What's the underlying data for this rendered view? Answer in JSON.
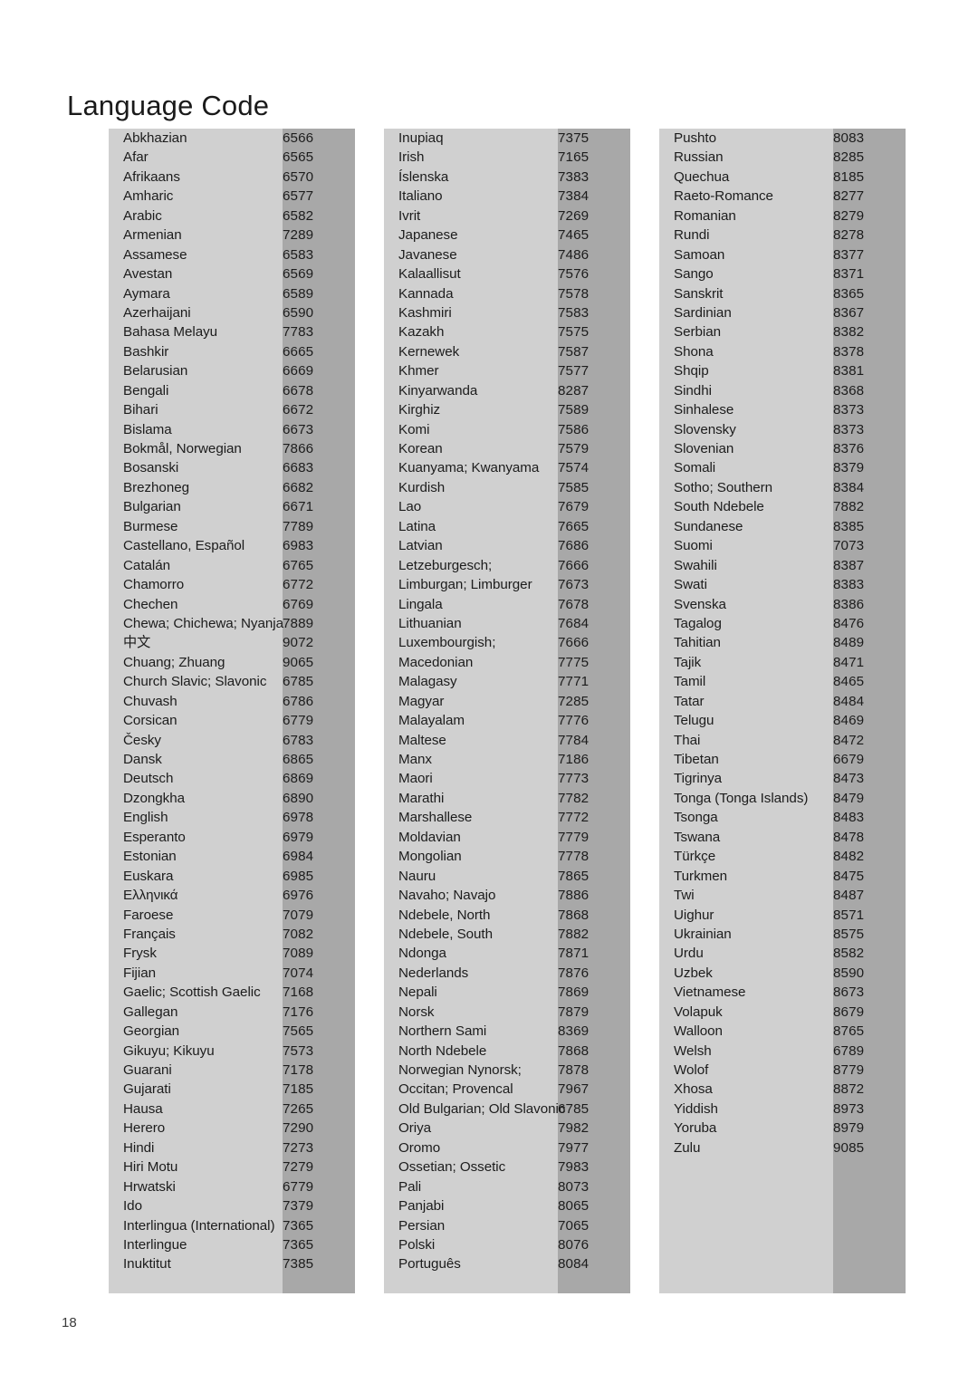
{
  "page": {
    "title": "Language Code",
    "page_number": "18",
    "colors": {
      "name_band": "#d0d0d0",
      "code_band": "#a8a8a8",
      "text": "#1c1c1c",
      "background": "#ffffff"
    }
  },
  "columns": [
    {
      "id": "column-1",
      "rows": [
        {
          "name": "Abkhazian",
          "code": "6566"
        },
        {
          "name": "Afar",
          "code": "6565"
        },
        {
          "name": "Afrikaans",
          "code": "6570"
        },
        {
          "name": "Amharic",
          "code": "6577"
        },
        {
          "name": "Arabic",
          "code": "6582"
        },
        {
          "name": "Armenian",
          "code": "7289"
        },
        {
          "name": "Assamese",
          "code": "6583"
        },
        {
          "name": "Avestan",
          "code": "6569"
        },
        {
          "name": "Aymara",
          "code": "6589"
        },
        {
          "name": "Azerhaijani",
          "code": "6590"
        },
        {
          "name": "Bahasa Melayu",
          "code": "7783"
        },
        {
          "name": "Bashkir",
          "code": "6665"
        },
        {
          "name": "Belarusian",
          "code": "6669"
        },
        {
          "name": "Bengali",
          "code": "6678"
        },
        {
          "name": "Bihari",
          "code": "6672"
        },
        {
          "name": "Bislama",
          "code": "6673"
        },
        {
          "name": "Bokmål, Norwegian",
          "code": "7866"
        },
        {
          "name": "Bosanski",
          "code": "6683"
        },
        {
          "name": "Brezhoneg",
          "code": "6682"
        },
        {
          "name": "Bulgarian",
          "code": "6671"
        },
        {
          "name": "Burmese",
          "code": "7789"
        },
        {
          "name": "Castellano, Español",
          "code": "6983"
        },
        {
          "name": "Catalán",
          "code": "6765"
        },
        {
          "name": "Chamorro",
          "code": "6772"
        },
        {
          "name": "Chechen",
          "code": "6769"
        },
        {
          "name": "Chewa; Chichewa; Nyanja",
          "code": "7889"
        },
        {
          "name": "中文",
          "code": "9072",
          "script": "cjk"
        },
        {
          "name": "Chuang; Zhuang",
          "code": "9065"
        },
        {
          "name": "Church Slavic; Slavonic",
          "code": "6785"
        },
        {
          "name": "Chuvash",
          "code": "6786"
        },
        {
          "name": "Corsican",
          "code": "6779"
        },
        {
          "name": "Česky",
          "code": "6783"
        },
        {
          "name": "Dansk",
          "code": "6865"
        },
        {
          "name": "Deutsch",
          "code": "6869"
        },
        {
          "name": "Dzongkha",
          "code": "6890"
        },
        {
          "name": "English",
          "code": "6978"
        },
        {
          "name": "Esperanto",
          "code": "6979"
        },
        {
          "name": "Estonian",
          "code": "6984"
        },
        {
          "name": "Euskara",
          "code": "6985"
        },
        {
          "name": "Ελληνικά",
          "code": "6976"
        },
        {
          "name": "Faroese",
          "code": "7079"
        },
        {
          "name": "Français",
          "code": "7082"
        },
        {
          "name": "Frysk",
          "code": "7089"
        },
        {
          "name": "Fijian",
          "code": "7074"
        },
        {
          "name": "Gaelic; Scottish Gaelic",
          "code": "7168"
        },
        {
          "name": "Gallegan",
          "code": "7176"
        },
        {
          "name": "Georgian",
          "code": "7565"
        },
        {
          "name": "Gikuyu; Kikuyu",
          "code": "7573"
        },
        {
          "name": "Guarani",
          "code": "7178"
        },
        {
          "name": "Gujarati",
          "code": "7185"
        },
        {
          "name": "Hausa",
          "code": "7265"
        },
        {
          "name": "Herero",
          "code": "7290"
        },
        {
          "name": "Hindi",
          "code": "7273"
        },
        {
          "name": "Hiri Motu",
          "code": "7279"
        },
        {
          "name": "Hrwatski",
          "code": "6779"
        },
        {
          "name": "Ido",
          "code": "7379"
        },
        {
          "name": "Interlingua (International)",
          "code": "7365"
        },
        {
          "name": "Interlingue",
          "code": "7365"
        },
        {
          "name": "Inuktitut",
          "code": "7385"
        }
      ]
    },
    {
      "id": "column-2",
      "rows": [
        {
          "name": "Inupiaq",
          "code": "7375"
        },
        {
          "name": "Irish",
          "code": "7165"
        },
        {
          "name": "Íslenska",
          "code": "7383"
        },
        {
          "name": "Italiano",
          "code": "7384"
        },
        {
          "name": "Ivrit",
          "code": "7269"
        },
        {
          "name": "Japanese",
          "code": "7465"
        },
        {
          "name": "Javanese",
          "code": "7486"
        },
        {
          "name": "Kalaallisut",
          "code": "7576"
        },
        {
          "name": "Kannada",
          "code": "7578"
        },
        {
          "name": "Kashmiri",
          "code": "7583"
        },
        {
          "name": "Kazakh",
          "code": "7575"
        },
        {
          "name": "Kernewek",
          "code": "7587"
        },
        {
          "name": "Khmer",
          "code": "7577"
        },
        {
          "name": "Kinyarwanda",
          "code": "8287"
        },
        {
          "name": "Kirghiz",
          "code": "7589"
        },
        {
          "name": "Komi",
          "code": "7586"
        },
        {
          "name": "Korean",
          "code": "7579"
        },
        {
          "name": "Kuanyama; Kwanyama",
          "code": "7574"
        },
        {
          "name": "Kurdish",
          "code": "7585"
        },
        {
          "name": "Lao",
          "code": "7679"
        },
        {
          "name": "Latina",
          "code": "7665"
        },
        {
          "name": "Latvian",
          "code": "7686"
        },
        {
          "name": "Letzeburgesch;",
          "code": "7666"
        },
        {
          "name": "Limburgan; Limburger",
          "code": "7673"
        },
        {
          "name": "Lingala",
          "code": "7678"
        },
        {
          "name": "Lithuanian",
          "code": "7684"
        },
        {
          "name": "Luxembourgish;",
          "code": "7666"
        },
        {
          "name": "Macedonian",
          "code": "7775"
        },
        {
          "name": "Malagasy",
          "code": "7771"
        },
        {
          "name": "Magyar",
          "code": "7285"
        },
        {
          "name": "Malayalam",
          "code": "7776"
        },
        {
          "name": "Maltese",
          "code": "7784"
        },
        {
          "name": "Manx",
          "code": "7186"
        },
        {
          "name": "Maori",
          "code": "7773"
        },
        {
          "name": "Marathi",
          "code": "7782"
        },
        {
          "name": "Marshallese",
          "code": "7772"
        },
        {
          "name": "Moldavian",
          "code": "7779"
        },
        {
          "name": "Mongolian",
          "code": "7778"
        },
        {
          "name": "Nauru",
          "code": "7865"
        },
        {
          "name": "Navaho; Navajo",
          "code": "7886"
        },
        {
          "name": "Ndebele, North",
          "code": "7868"
        },
        {
          "name": "Ndebele, South",
          "code": "7882"
        },
        {
          "name": "Ndonga",
          "code": "7871"
        },
        {
          "name": "Nederlands",
          "code": "7876"
        },
        {
          "name": "Nepali",
          "code": "7869"
        },
        {
          "name": "Norsk",
          "code": "7879"
        },
        {
          "name": "Northern Sami",
          "code": "8369"
        },
        {
          "name": "North Ndebele",
          "code": "7868"
        },
        {
          "name": "Norwegian Nynorsk;",
          "code": "7878"
        },
        {
          "name": "Occitan; Provencal",
          "code": "7967"
        },
        {
          "name": "Old Bulgarian; Old Slavonic",
          "code": "6785"
        },
        {
          "name": "Oriya",
          "code": "7982"
        },
        {
          "name": "Oromo",
          "code": "7977"
        },
        {
          "name": "Ossetian; Ossetic",
          "code": "7983"
        },
        {
          "name": "Pali",
          "code": "8073"
        },
        {
          "name": "Panjabi",
          "code": "8065"
        },
        {
          "name": "Persian",
          "code": "7065"
        },
        {
          "name": "Polski",
          "code": "8076"
        },
        {
          "name": "Português",
          "code": "8084"
        }
      ]
    },
    {
      "id": "column-3",
      "rows": [
        {
          "name": "Pushto",
          "code": "8083"
        },
        {
          "name": "Russian",
          "code": "8285"
        },
        {
          "name": "Quechua",
          "code": "8185"
        },
        {
          "name": "Raeto-Romance",
          "code": "8277"
        },
        {
          "name": "Romanian",
          "code": "8279"
        },
        {
          "name": "Rundi",
          "code": "8278"
        },
        {
          "name": "Samoan",
          "code": "8377"
        },
        {
          "name": "Sango",
          "code": "8371"
        },
        {
          "name": "Sanskrit",
          "code": "8365"
        },
        {
          "name": "Sardinian",
          "code": "8367"
        },
        {
          "name": "Serbian",
          "code": "8382"
        },
        {
          "name": "Shona",
          "code": "8378"
        },
        {
          "name": "Shqip",
          "code": "8381"
        },
        {
          "name": "Sindhi",
          "code": "8368"
        },
        {
          "name": "Sinhalese",
          "code": "8373"
        },
        {
          "name": "Slovensky",
          "code": "8373"
        },
        {
          "name": "Slovenian",
          "code": "8376"
        },
        {
          "name": "Somali",
          "code": "8379"
        },
        {
          "name": "Sotho; Southern",
          "code": "8384"
        },
        {
          "name": "South Ndebele",
          "code": "7882"
        },
        {
          "name": "Sundanese",
          "code": "8385"
        },
        {
          "name": "Suomi",
          "code": "7073"
        },
        {
          "name": "Swahili",
          "code": "8387"
        },
        {
          "name": "Swati",
          "code": "8383"
        },
        {
          "name": "Svenska",
          "code": "8386"
        },
        {
          "name": "Tagalog",
          "code": "8476"
        },
        {
          "name": "Tahitian",
          "code": "8489"
        },
        {
          "name": "Tajik",
          "code": "8471"
        },
        {
          "name": "Tamil",
          "code": "8465"
        },
        {
          "name": "Tatar",
          "code": "8484"
        },
        {
          "name": "Telugu",
          "code": "8469"
        },
        {
          "name": "Thai",
          "code": "8472"
        },
        {
          "name": "Tibetan",
          "code": "6679"
        },
        {
          "name": "Tigrinya",
          "code": "8473"
        },
        {
          "name": "Tonga (Tonga Islands)",
          "code": "8479"
        },
        {
          "name": "Tsonga",
          "code": "8483"
        },
        {
          "name": "Tswana",
          "code": "8478"
        },
        {
          "name": "Türkçe",
          "code": "8482"
        },
        {
          "name": "Turkmen",
          "code": "8475"
        },
        {
          "name": "Twi",
          "code": "8487"
        },
        {
          "name": "Uighur",
          "code": "8571"
        },
        {
          "name": "Ukrainian",
          "code": "8575"
        },
        {
          "name": "Urdu",
          "code": "8582"
        },
        {
          "name": "Uzbek",
          "code": "8590"
        },
        {
          "name": "Vietnamese",
          "code": "8673"
        },
        {
          "name": "Volapuk",
          "code": "8679"
        },
        {
          "name": "Walloon",
          "code": "8765"
        },
        {
          "name": "Welsh",
          "code": "6789"
        },
        {
          "name": "Wolof",
          "code": "8779"
        },
        {
          "name": "Xhosa",
          "code": "8872"
        },
        {
          "name": "Yiddish",
          "code": "8973"
        },
        {
          "name": "Yoruba",
          "code": "8979"
        },
        {
          "name": "Zulu",
          "code": "9085"
        }
      ]
    }
  ]
}
